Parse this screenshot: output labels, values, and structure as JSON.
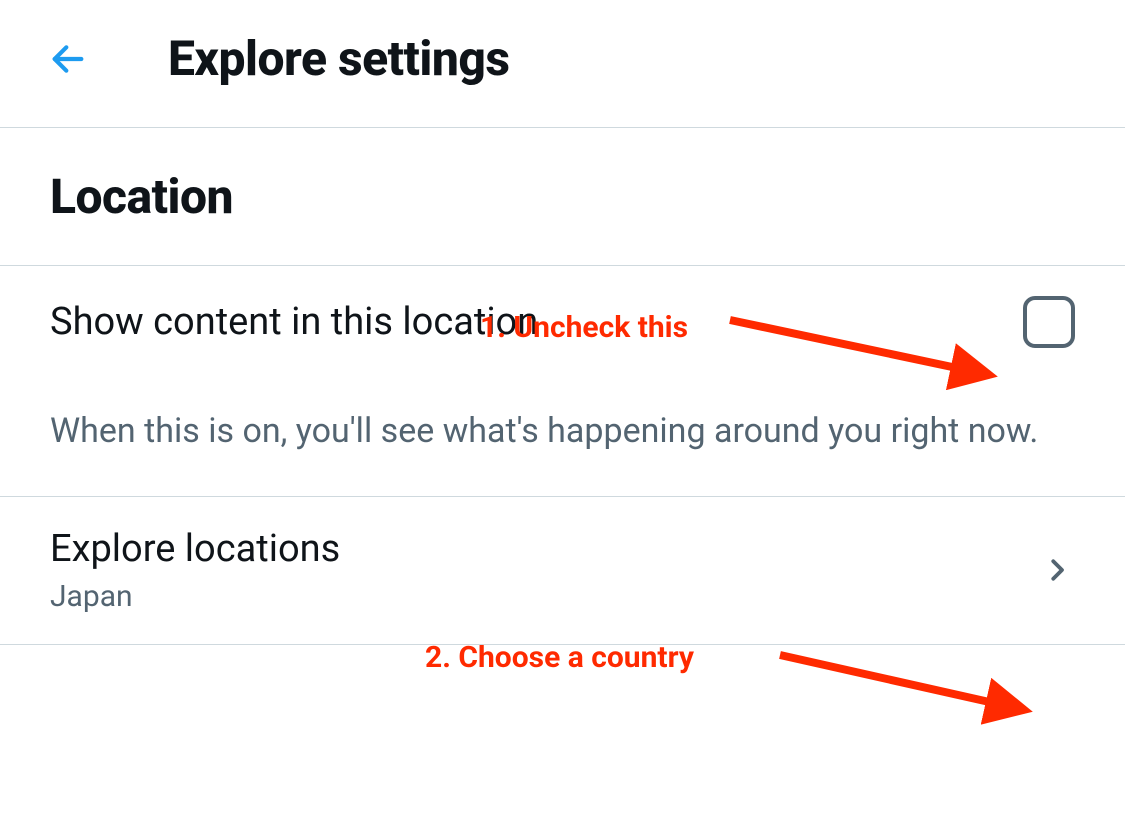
{
  "header": {
    "title": "Explore settings"
  },
  "section": {
    "heading": "Location"
  },
  "settings": {
    "show_content": {
      "label": "Show content in this location",
      "description": "When this is on, you'll see what's happening around you right now.",
      "checked": false
    },
    "explore_locations": {
      "label": "Explore locations",
      "value": "Japan"
    }
  },
  "annotations": {
    "step1": "1. Uncheck this",
    "step2": "2. Choose a country"
  },
  "colors": {
    "accent": "#1d9bf0",
    "text_primary": "#0f1419",
    "text_secondary": "#536471",
    "annotation": "#ff2a00",
    "border": "#cfd9de"
  }
}
